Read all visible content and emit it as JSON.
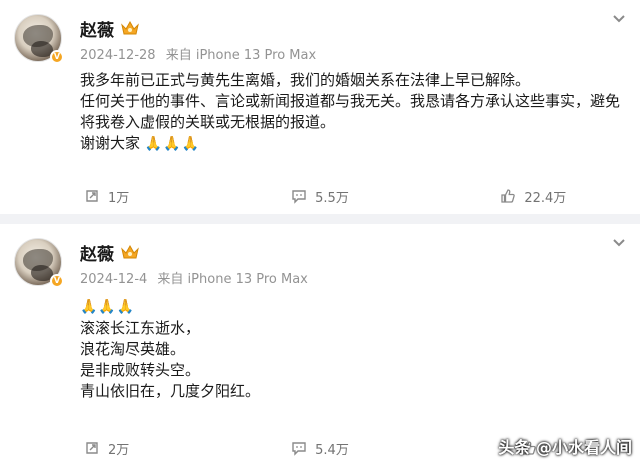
{
  "posts": [
    {
      "author": "赵薇",
      "date": "2024-12-28",
      "source": "来自 iPhone 13 Pro Max",
      "lines": [
        "我多年前已正式与黄先生离婚，我们的婚姻关系在法律上早已解除。",
        "任何关于他的事件、言论或新闻报道都与我无关。我恳请各方承认这些事实，避免将我卷入虚假的关联或无根据的报道。",
        "谢谢大家"
      ],
      "emoji": "🙏🙏🙏",
      "repost_count": "1万",
      "comment_count": "5.5万",
      "like_count": "22.4万"
    },
    {
      "author": "赵薇",
      "date": "2024-12-4",
      "source": "来自 iPhone 13 Pro Max",
      "emoji": "🙏🙏🙏",
      "lines": [
        "滚滚长江东逝水，",
        "浪花淘尽英雄。",
        "是非成败转头空。",
        "青山依旧在，几度夕阳红。"
      ],
      "repost_count": "2万",
      "comment_count": "5.4万"
    }
  ],
  "watermark": "头条 @小水看人间",
  "colors": {
    "accent_badge": "#f5a623",
    "meta_gray": "#939393",
    "bg": "#f1f2f5"
  },
  "icons": [
    "avatar",
    "verified-badge-icon",
    "crown-icon",
    "chevron-down-icon",
    "repost-icon",
    "comment-icon",
    "like-icon",
    "pray-emoji"
  ]
}
